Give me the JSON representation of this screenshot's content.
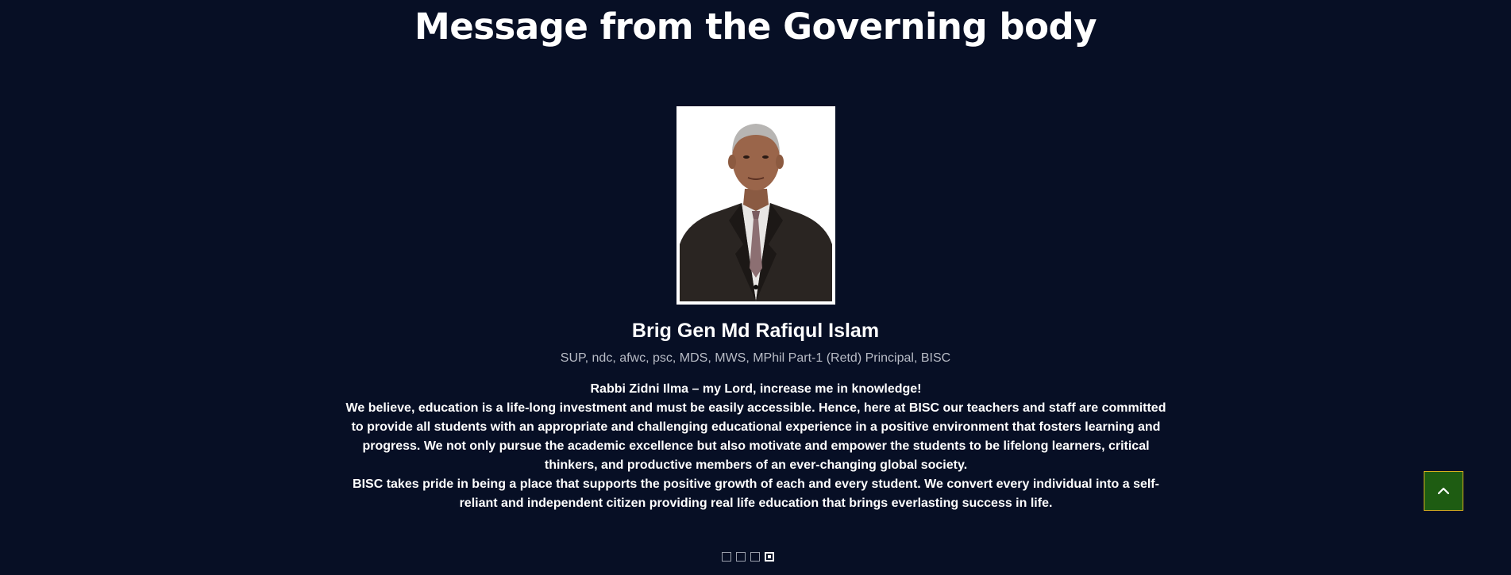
{
  "section": {
    "title": "Message from the Governing body"
  },
  "person": {
    "name": "Brig Gen Md Rafiqul Islam",
    "title": "SUP, ndc, afwc, psc, MDS, MWS, MPhil Part-1 (Retd) Principal, BISC"
  },
  "message": {
    "lines": [
      "Rabbi Zidni Ilma – my Lord, increase me in knowledge!",
      "We believe, education is a life-long investment and must be easily accessible. Hence, here at BISC our teachers and staff are committed to provide all students with an appropriate and challenging educational experience in a positive environment that fosters learning and progress. We not only pursue the academic excellence but also motivate and empower the students to be lifelong learners, critical thinkers, and productive members of an ever-changing global society.",
      "BISC takes pride in being a place that supports the positive growth of each and every student. We convert every individual into a self-reliant and independent citizen providing real life education that brings everlasting success in life."
    ]
  },
  "carousel": {
    "total_slides": 4,
    "active_slide": 4
  },
  "icons": {
    "scroll_top": "chevron-up-icon",
    "slide_dot": "square-dot-icon"
  },
  "colors": {
    "background": "#070f25",
    "scroll_button": "#1e5c12",
    "scroll_button_border": "#d6b01e"
  }
}
